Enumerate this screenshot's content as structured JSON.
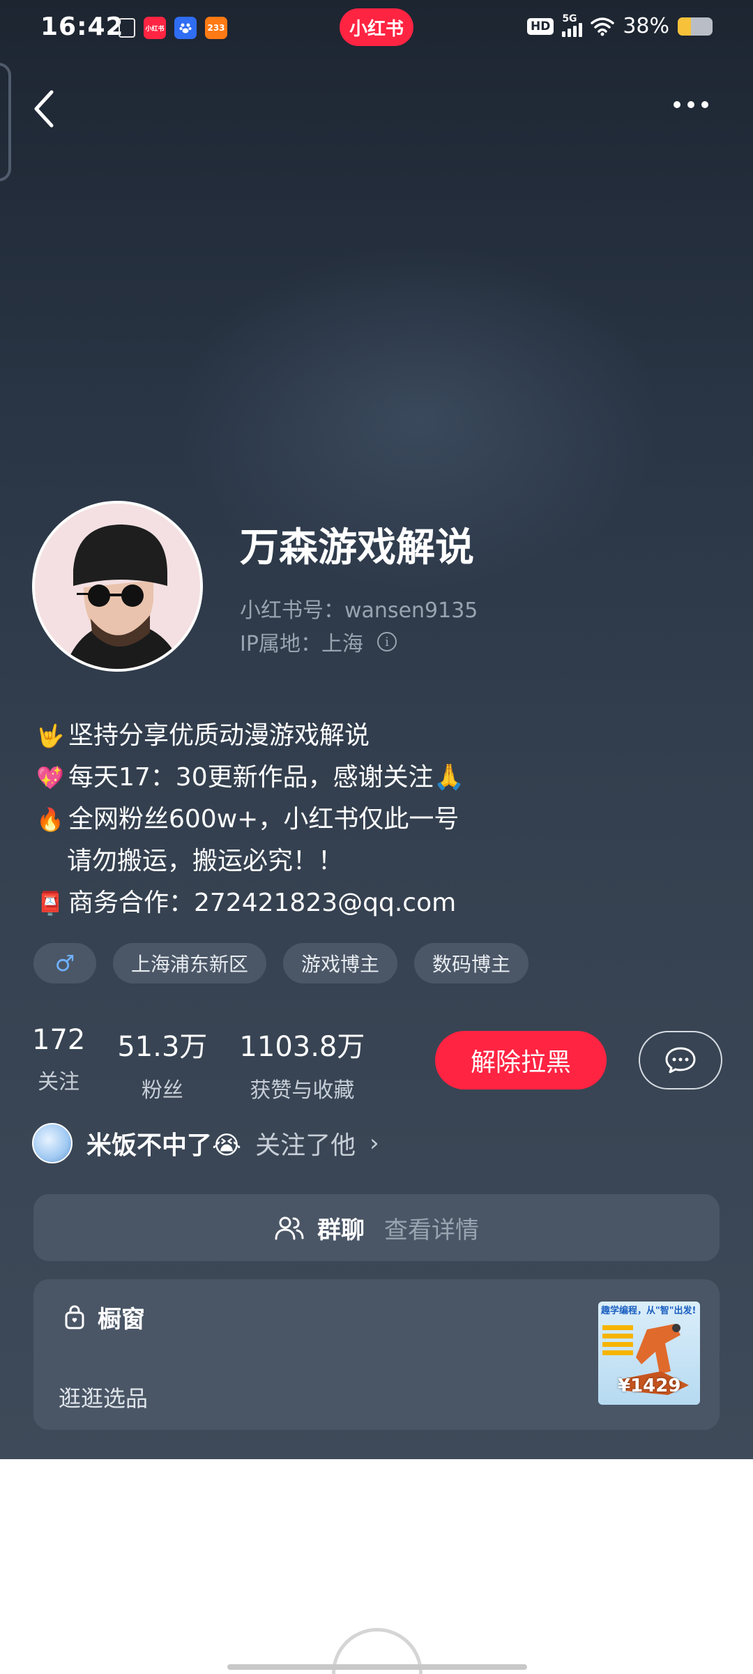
{
  "status_bar": {
    "time": "16:42",
    "app_name": "小红书",
    "notif_xhs": "小红书",
    "notif_233": "233",
    "network": "5G",
    "hd": "HD",
    "battery_percent": "38%",
    "battery_level": 0.38,
    "battery_color": "#f7c23a"
  },
  "profile": {
    "name": "万森游戏解说",
    "id_line": "小红书号：wansen9135",
    "ip_line": "IP属地：上海",
    "info_glyph": "i"
  },
  "bio": [
    {
      "emoji": "🤟",
      "text": "坚持分享优质动漫游戏解说"
    },
    {
      "emoji": "💖",
      "text": "每天17：30更新作品，感谢关注🙏"
    },
    {
      "emoji": "🔥",
      "text": "全网粉丝600w+，小红书仅此一号"
    },
    {
      "emoji": "",
      "text": "请勿搬运，搬运必究！！"
    },
    {
      "emoji": "📮",
      "text": "商务合作：272421823@qq.com"
    }
  ],
  "tags": {
    "gender": "♂",
    "location": "上海浦东新区",
    "tag1": "游戏博主",
    "tag2": "数码博主"
  },
  "stats": {
    "following_value": "172",
    "following_label": "关注",
    "fans_value": "51.3万",
    "fans_label": "粉丝",
    "likes_value": "1103.8万",
    "likes_label": "获赞与收藏"
  },
  "actions": {
    "unblock_label": "解除拉黑"
  },
  "followed_by": {
    "name": "米饭不中了😭",
    "text": "关注了他",
    "chevron": "›"
  },
  "group_chat": {
    "title": "群聊",
    "detail": "查看详情"
  },
  "shop": {
    "title": "橱窗",
    "subtitle": "逛逛选品",
    "product_title": "趣学编程，从\"智\"出发!",
    "product_price": "¥1429"
  },
  "colors": {
    "accent": "#ff2442",
    "background_top": "#1d2531",
    "background_bottom": "#3e4a59",
    "card": "#4a5666",
    "muted_text": "#9aa4b1"
  }
}
